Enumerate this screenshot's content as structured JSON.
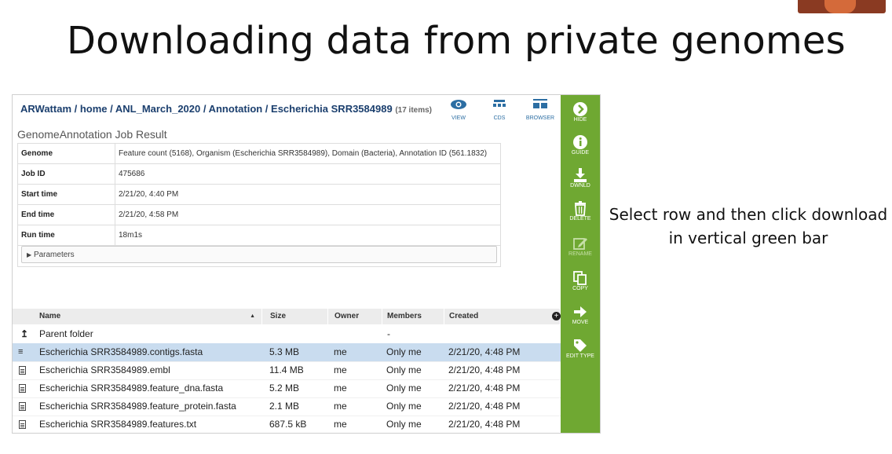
{
  "slide": {
    "title": "Downloading data from private genomes",
    "instructions_line1": "Select row and then click download",
    "instructions_line2": "in vertical green bar"
  },
  "breadcrumb": {
    "path": "ARWattam / home / ANL_March_2020 / Annotation / Escherichia SRR3584989",
    "count": "(17 items)"
  },
  "top_icons": [
    {
      "label": "VIEW",
      "icon": "eye-icon"
    },
    {
      "label": "CDS",
      "icon": "cds-icon"
    },
    {
      "label": "BROWSER",
      "icon": "browser-icon"
    }
  ],
  "job": {
    "header": "GenomeAnnotation Job Result",
    "rows": [
      {
        "key": "Genome",
        "value": "Feature count (5168), Organism (Escherichia SRR3584989), Domain (Bacteria), Annotation ID (561.1832)"
      },
      {
        "key": "Job ID",
        "value": "475686"
      },
      {
        "key": "Start time",
        "value": "2/21/20, 4:40 PM"
      },
      {
        "key": "End time",
        "value": "2/21/20, 4:58 PM"
      },
      {
        "key": "Run time",
        "value": "18m1s"
      }
    ],
    "parameters_label": "Parameters"
  },
  "files": {
    "columns": [
      "Name",
      "Size",
      "Owner",
      "Members",
      "Created"
    ],
    "sort_indicator": "▲",
    "parent": {
      "name": "Parent folder",
      "members": "-"
    },
    "rows": [
      {
        "name": "Escherichia SRR3584989.contigs.fasta",
        "size": "5.3 MB",
        "owner": "me",
        "members": "Only me",
        "created": "2/21/20, 4:48 PM",
        "selected": true
      },
      {
        "name": "Escherichia SRR3584989.embl",
        "size": "11.4 MB",
        "owner": "me",
        "members": "Only me",
        "created": "2/21/20, 4:48 PM"
      },
      {
        "name": "Escherichia SRR3584989.feature_dna.fasta",
        "size": "5.2 MB",
        "owner": "me",
        "members": "Only me",
        "created": "2/21/20, 4:48 PM"
      },
      {
        "name": "Escherichia SRR3584989.feature_protein.fasta",
        "size": "2.1 MB",
        "owner": "me",
        "members": "Only me",
        "created": "2/21/20, 4:48 PM"
      },
      {
        "name": "Escherichia SRR3584989.features.txt",
        "size": "687.5 kB",
        "owner": "me",
        "members": "Only me",
        "created": "2/21/20, 4:48 PM"
      }
    ]
  },
  "actions": [
    {
      "label": "HIDE",
      "icon": "chevron-right-icon"
    },
    {
      "label": "GUIDE",
      "icon": "info-icon"
    },
    {
      "label": "DWNLD",
      "icon": "download-icon"
    },
    {
      "label": "DELETE",
      "icon": "trash-icon"
    },
    {
      "label": "RENAME",
      "icon": "edit-icon",
      "disabled": true
    },
    {
      "label": "COPY",
      "icon": "copy-icon"
    },
    {
      "label": "MOVE",
      "icon": "arrow-right-icon"
    },
    {
      "label": "EDIT TYPE",
      "icon": "tag-icon"
    }
  ],
  "colors": {
    "action_bar": "#6fa832",
    "selected_row": "#c9dcef",
    "link": "#1b3f6e"
  }
}
